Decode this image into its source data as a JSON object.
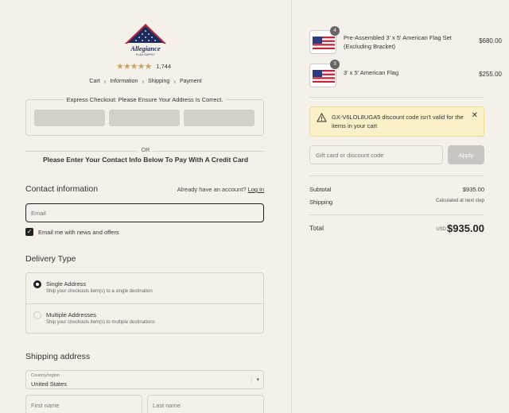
{
  "brand": {
    "logo_text": "Allegiance",
    "logo_subtext": "FLAG SUPPLY",
    "rating_count": "1,744",
    "stars": "★★★★★"
  },
  "breadcrumb": {
    "items": [
      "Cart",
      "Information",
      "Shipping",
      "Payment"
    ],
    "separator": "›"
  },
  "express": {
    "title": "Express Checkout: Please Ensure Your Address Is Correct."
  },
  "divider": {
    "or": "OR",
    "credit_card": "Please Enter Your Contact Info Below To Pay With A Credit Card"
  },
  "contact": {
    "title": "Contact information",
    "account_prompt": "Already have an account?",
    "login_link": "Log in",
    "email_placeholder": "Email",
    "newsletter_label": "Email me with news and offers",
    "newsletter_checked": true
  },
  "delivery": {
    "title": "Delivery Type",
    "options": [
      {
        "label": "Single Address",
        "sub": "Ship your checkouts item(s) to a single destination",
        "selected": true
      },
      {
        "label": "Multiple Addresses",
        "sub": "Ship your checkouts item(s) to multiple destinations",
        "selected": false
      }
    ]
  },
  "shipping": {
    "title": "Shipping address",
    "country_label": "Country/region",
    "country_value": "United States",
    "first_name_placeholder": "First name",
    "last_name_placeholder": "Last name"
  },
  "cart": {
    "items": [
      {
        "qty": "4",
        "name": "Pre-Assembled 3' x 5' American Flag Set (Excluding Bracket)",
        "price": "$680.00"
      },
      {
        "qty": "3",
        "name": "3' x 5' American Flag",
        "price": "$255.00"
      }
    ],
    "alert_text": "GX-V6LOL8UGA5 discount code isn't valid for the items in your cart",
    "discount_placeholder": "Gift card or discount code",
    "apply_label": "Apply",
    "subtotal_label": "Subtotal",
    "subtotal_value": "$935.00",
    "shipping_label": "Shipping",
    "shipping_value": "Calculated at next step",
    "total_label": "Total",
    "currency": "USD",
    "total_value": "$935.00"
  },
  "colors": {
    "background": "#f5f1ea",
    "logo_navy": "#1c2a5c",
    "logo_red": "#b0283a",
    "star_gold": "#c9a562",
    "alert_bg": "#fbf1c8"
  }
}
